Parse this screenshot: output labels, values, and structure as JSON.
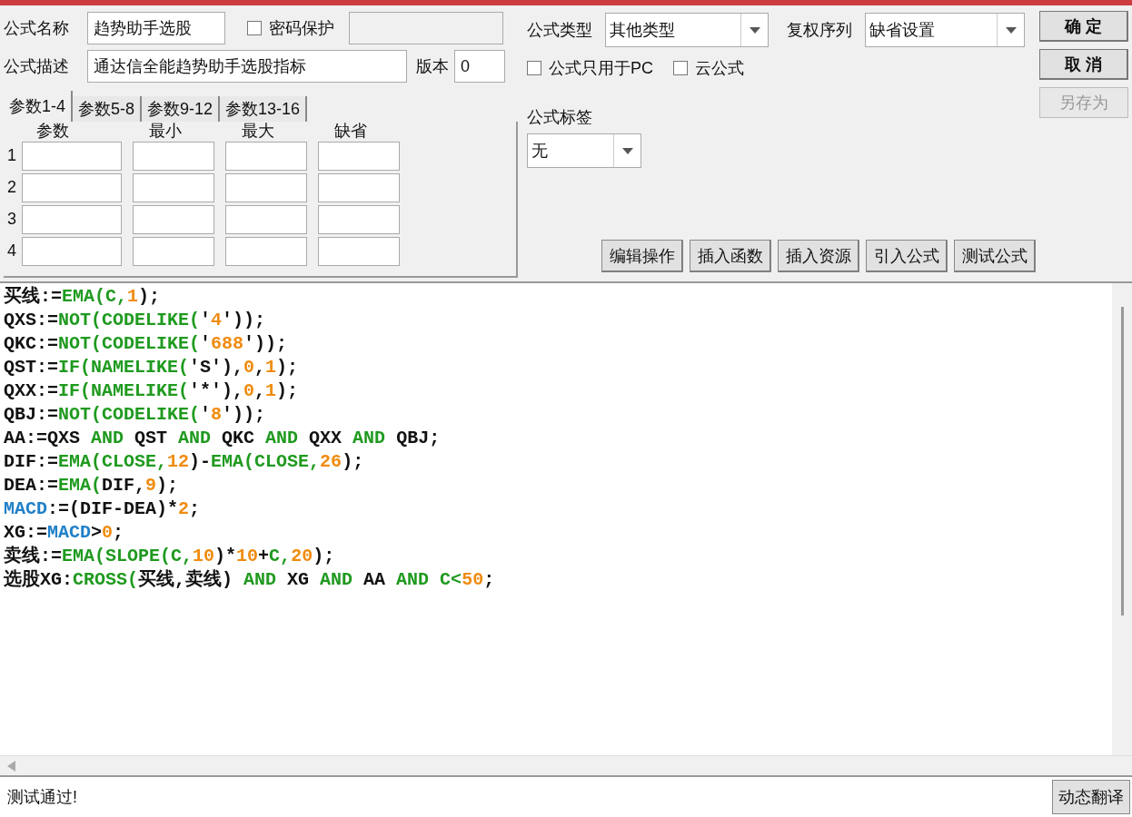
{
  "form": {
    "name_label": "公式名称",
    "name_value": "趋势助手选股",
    "password": {
      "label": "密码保护",
      "checked": false
    },
    "description_label": "公式描述",
    "description_value": "通达信全能趋势助手选股指标",
    "version_label": "版本",
    "version_value": "0"
  },
  "param_tabs": [
    {
      "label": "参数1-4",
      "selected": true
    },
    {
      "label": "参数5-8",
      "selected": false
    },
    {
      "label": "参数9-12",
      "selected": false
    },
    {
      "label": "参数13-16",
      "selected": false
    }
  ],
  "param_columns": [
    "参数",
    "最小",
    "最大",
    "缺省"
  ],
  "param_rows": [
    "1",
    "2",
    "3",
    "4"
  ],
  "type": {
    "label": "公式类型",
    "value": "其他类型"
  },
  "rights": {
    "label": "复权序列",
    "value": "缺省设置"
  },
  "options": [
    {
      "label": "公式只用于PC",
      "checked": false
    },
    {
      "label": "云公式",
      "checked": false
    }
  ],
  "tag": {
    "label": "公式标签",
    "value": "无"
  },
  "dialog_buttons": [
    {
      "label": "确 定",
      "disabled": false
    },
    {
      "label": "取 消",
      "disabled": false
    },
    {
      "label": "另存为",
      "disabled": true
    }
  ],
  "tool_buttons": [
    "编辑操作",
    "插入函数",
    "插入资源",
    "引入公式",
    "测试公式"
  ],
  "code_lines": [
    [
      {
        "kind": "plain",
        "text": "买线:="
      },
      {
        "kind": "func",
        "text": "EMA(C,"
      },
      {
        "kind": "num",
        "text": "1"
      },
      {
        "kind": "plain",
        "text": ");"
      }
    ],
    [
      {
        "kind": "plain",
        "text": "QXS:="
      },
      {
        "kind": "func",
        "text": "NOT(CODELIKE("
      },
      {
        "kind": "plain",
        "text": "'"
      },
      {
        "kind": "num",
        "text": "4"
      },
      {
        "kind": "plain",
        "text": "'));"
      }
    ],
    [
      {
        "kind": "plain",
        "text": "QKC:="
      },
      {
        "kind": "func",
        "text": "NOT(CODELIKE("
      },
      {
        "kind": "plain",
        "text": "'"
      },
      {
        "kind": "num",
        "text": "688"
      },
      {
        "kind": "plain",
        "text": "'));"
      }
    ],
    [
      {
        "kind": "plain",
        "text": "QST:="
      },
      {
        "kind": "func",
        "text": "IF(NAMELIKE("
      },
      {
        "kind": "plain",
        "text": "'S'),"
      },
      {
        "kind": "num",
        "text": "0"
      },
      {
        "kind": "plain",
        "text": ","
      },
      {
        "kind": "num",
        "text": "1"
      },
      {
        "kind": "plain",
        "text": ");"
      }
    ],
    [
      {
        "kind": "plain",
        "text": "QXX:="
      },
      {
        "kind": "func",
        "text": "IF(NAMELIKE("
      },
      {
        "kind": "plain",
        "text": "'*'),"
      },
      {
        "kind": "num",
        "text": "0"
      },
      {
        "kind": "plain",
        "text": ","
      },
      {
        "kind": "num",
        "text": "1"
      },
      {
        "kind": "plain",
        "text": ");"
      }
    ],
    [
      {
        "kind": "plain",
        "text": "QBJ:="
      },
      {
        "kind": "func",
        "text": "NOT(CODELIKE("
      },
      {
        "kind": "plain",
        "text": "'"
      },
      {
        "kind": "num",
        "text": "8"
      },
      {
        "kind": "plain",
        "text": "'));"
      }
    ],
    [
      {
        "kind": "plain",
        "text": "AA:=QXS "
      },
      {
        "kind": "func",
        "text": "AND"
      },
      {
        "kind": "plain",
        "text": " QST "
      },
      {
        "kind": "func",
        "text": "AND"
      },
      {
        "kind": "plain",
        "text": " QKC "
      },
      {
        "kind": "func",
        "text": "AND"
      },
      {
        "kind": "plain",
        "text": " QXX "
      },
      {
        "kind": "func",
        "text": "AND"
      },
      {
        "kind": "plain",
        "text": " QBJ;"
      }
    ],
    [
      {
        "kind": "plain",
        "text": "DIF:="
      },
      {
        "kind": "func",
        "text": "EMA(CLOSE,"
      },
      {
        "kind": "num",
        "text": "12"
      },
      {
        "kind": "plain",
        "text": ")-"
      },
      {
        "kind": "func",
        "text": "EMA(CLOSE,"
      },
      {
        "kind": "num",
        "text": "26"
      },
      {
        "kind": "plain",
        "text": ");"
      }
    ],
    [
      {
        "kind": "plain",
        "text": "DEA:="
      },
      {
        "kind": "func",
        "text": "EMA("
      },
      {
        "kind": "plain",
        "text": "DIF,"
      },
      {
        "kind": "num",
        "text": "9"
      },
      {
        "kind": "plain",
        "text": ");"
      }
    ],
    [
      {
        "kind": "var",
        "text": "MACD"
      },
      {
        "kind": "plain",
        "text": ":=(DIF-DEA)*"
      },
      {
        "kind": "num",
        "text": "2"
      },
      {
        "kind": "plain",
        "text": ";"
      }
    ],
    [
      {
        "kind": "plain",
        "text": "XG:="
      },
      {
        "kind": "var",
        "text": "MACD"
      },
      {
        "kind": "plain",
        "text": ">"
      },
      {
        "kind": "num",
        "text": "0"
      },
      {
        "kind": "plain",
        "text": ";"
      }
    ],
    [
      {
        "kind": "plain",
        "text": "卖线:="
      },
      {
        "kind": "func",
        "text": "EMA(SLOPE(C,"
      },
      {
        "kind": "num",
        "text": "10"
      },
      {
        "kind": "plain",
        "text": ")*"
      },
      {
        "kind": "num",
        "text": "10"
      },
      {
        "kind": "plain",
        "text": "+"
      },
      {
        "kind": "func",
        "text": "C,"
      },
      {
        "kind": "num",
        "text": "20"
      },
      {
        "kind": "plain",
        "text": ");"
      }
    ],
    [
      {
        "kind": "plain",
        "text": "选股XG:"
      },
      {
        "kind": "func",
        "text": "CROSS("
      },
      {
        "kind": "plain",
        "text": "买线,卖线) "
      },
      {
        "kind": "func",
        "text": "AND"
      },
      {
        "kind": "plain",
        "text": " XG "
      },
      {
        "kind": "func",
        "text": "AND"
      },
      {
        "kind": "plain",
        "text": " AA "
      },
      {
        "kind": "func",
        "text": "AND C<"
      },
      {
        "kind": "num",
        "text": "50"
      },
      {
        "kind": "plain",
        "text": ";"
      }
    ]
  ],
  "status": {
    "message": "测试通过!",
    "button": "动态翻译"
  }
}
